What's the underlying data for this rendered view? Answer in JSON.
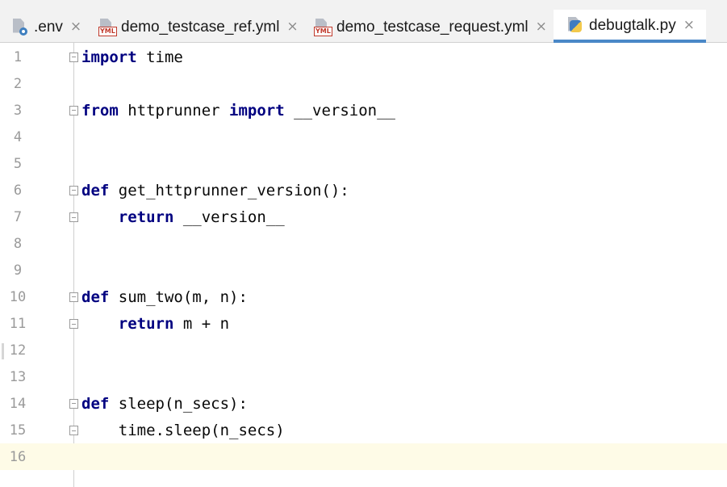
{
  "tabs": [
    {
      "label": ".env",
      "icon": "env-file-icon",
      "active": false,
      "close": "×"
    },
    {
      "label": "demo_testcase_ref.yml",
      "icon": "yml-file-icon",
      "active": false,
      "close": "×"
    },
    {
      "label": "demo_testcase_request.yml",
      "icon": "yml-file-icon",
      "active": false,
      "close": "×"
    },
    {
      "label": "debugtalk.py",
      "icon": "python-file-icon",
      "active": true,
      "close": "×"
    }
  ],
  "yml_badge": "YML",
  "editor": {
    "current_line": 16,
    "lines": [
      {
        "num": "1",
        "parts": [
          {
            "t": "import",
            "k": true
          },
          {
            "t": " time"
          }
        ]
      },
      {
        "num": "2",
        "parts": []
      },
      {
        "num": "3",
        "parts": [
          {
            "t": "from",
            "k": true
          },
          {
            "t": " httprunner "
          },
          {
            "t": "import",
            "k": true
          },
          {
            "t": " __version__"
          }
        ]
      },
      {
        "num": "4",
        "parts": []
      },
      {
        "num": "5",
        "parts": []
      },
      {
        "num": "6",
        "parts": [
          {
            "t": "def",
            "k": true
          },
          {
            "t": " get_httprunner_version():"
          }
        ]
      },
      {
        "num": "7",
        "parts": [
          {
            "t": "    "
          },
          {
            "t": "return",
            "k": true
          },
          {
            "t": " __version__"
          }
        ]
      },
      {
        "num": "8",
        "parts": []
      },
      {
        "num": "9",
        "parts": []
      },
      {
        "num": "10",
        "parts": [
          {
            "t": "def",
            "k": true
          },
          {
            "t": " sum_two(m, n):"
          }
        ]
      },
      {
        "num": "11",
        "parts": [
          {
            "t": "    "
          },
          {
            "t": "return",
            "k": true
          },
          {
            "t": " m + n"
          }
        ]
      },
      {
        "num": "12",
        "parts": []
      },
      {
        "num": "13",
        "parts": []
      },
      {
        "num": "14",
        "parts": [
          {
            "t": "def",
            "k": true
          },
          {
            "t": " sleep(n_secs):"
          }
        ]
      },
      {
        "num": "15",
        "parts": [
          {
            "t": "    time.sleep(n_secs)"
          }
        ]
      },
      {
        "num": "16",
        "parts": []
      }
    ]
  },
  "colors": {
    "keyword": "#000080",
    "active_tab_underline": "#4a88c7",
    "current_line_bg": "#fefbe7"
  }
}
